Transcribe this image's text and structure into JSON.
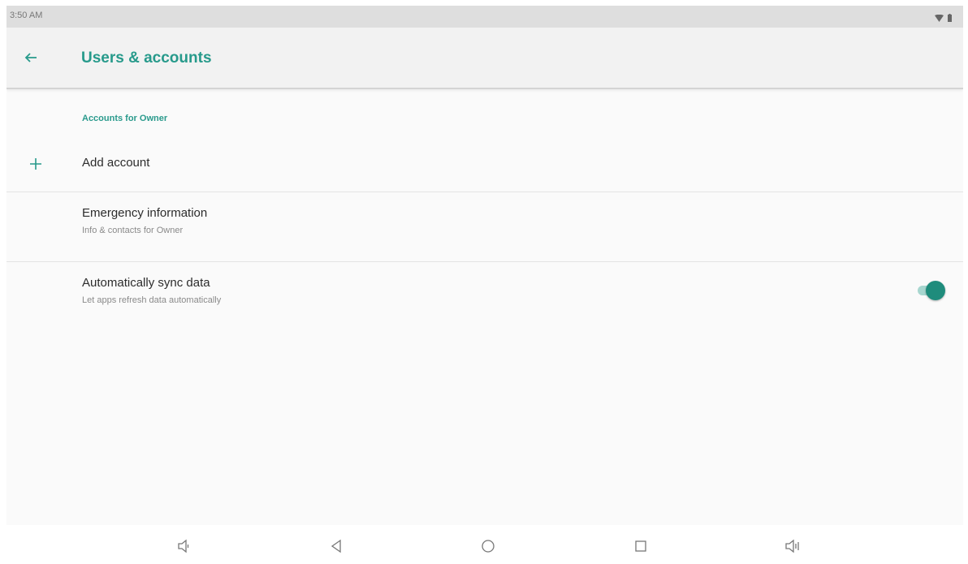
{
  "status_bar": {
    "time": "3:50 AM",
    "icons": [
      "wifi-icon",
      "battery-icon"
    ]
  },
  "app_bar": {
    "title": "Users & accounts",
    "back_icon": "arrow-back-icon"
  },
  "section": {
    "header": "Accounts for Owner"
  },
  "rows": {
    "add_account": {
      "icon": "plus-icon",
      "title": "Add account"
    },
    "emergency": {
      "title": "Emergency information",
      "summary": "Info & contacts for Owner"
    },
    "sync": {
      "title": "Automatically sync data",
      "summary": "Let apps refresh data automatically",
      "enabled": true
    }
  },
  "nav_bar": {
    "icons": [
      "volume-down-icon",
      "back-triangle-icon",
      "home-circle-icon",
      "recents-square-icon",
      "volume-up-icon"
    ]
  },
  "colors": {
    "accent": "#279a8b",
    "toggle_thumb": "#1f8c7c",
    "toggle_track": "#a7d6cf"
  }
}
